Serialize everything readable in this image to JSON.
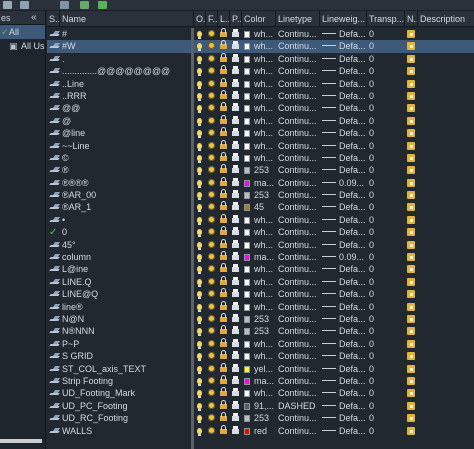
{
  "toolbar": {
    "icons": [
      "new-layer-icon",
      "layer-state-icon",
      "layer-filter-icon",
      "refresh-icon"
    ]
  },
  "left_pane": {
    "header_label": "es",
    "collapse_label": "«",
    "items": [
      {
        "label": "All",
        "glyph": "✓",
        "selected": true
      },
      {
        "label": "All Us",
        "glyph": "▣",
        "selected": false
      }
    ]
  },
  "columns": {
    "status": "S..",
    "name": "Name",
    "on": "O..",
    "freeze": "F..",
    "lock": "L..",
    "plot": "P..",
    "color": "Color",
    "linetype": "Linetype",
    "lineweight": "Lineweig...",
    "transparency": "Transp...",
    "new_vp_freeze": "N..",
    "description": "Description"
  },
  "layers": [
    {
      "name": "#",
      "color": "wh...",
      "swatch": "#ffffff",
      "linetype": "Continu...",
      "lineweight": "Defa...",
      "transp": "0",
      "current": false,
      "selected": false
    },
    {
      "name": "#W",
      "color": "wh...",
      "swatch": "#ffffff",
      "linetype": "Continu...",
      "lineweight": "Defa...",
      "transp": "0",
      "current": false,
      "selected": true
    },
    {
      "name": ".",
      "color": "wh...",
      "swatch": "#ffffff",
      "linetype": "Continu...",
      "lineweight": "Defa...",
      "transp": "0",
      "current": false,
      "selected": false
    },
    {
      "name": "..............@@@@@@@@",
      "color": "wh...",
      "swatch": "#ffffff",
      "linetype": "Continu...",
      "lineweight": "Defa...",
      "transp": "0",
      "current": false,
      "selected": false
    },
    {
      "name": "..Line",
      "color": "wh...",
      "swatch": "#ffffff",
      "linetype": "Continu...",
      "lineweight": "Defa...",
      "transp": "0",
      "current": false,
      "selected": false
    },
    {
      "name": "..RRR",
      "color": "wh...",
      "swatch": "#ffffff",
      "linetype": "Continu...",
      "lineweight": "Defa...",
      "transp": "0",
      "current": false,
      "selected": false
    },
    {
      "name": "@@",
      "color": "wh...",
      "swatch": "#ffffff",
      "linetype": "Continu...",
      "lineweight": "Defa...",
      "transp": "0",
      "current": false,
      "selected": false
    },
    {
      "name": "@",
      "color": "wh...",
      "swatch": "#ffffff",
      "linetype": "Continu...",
      "lineweight": "Defa...",
      "transp": "0",
      "current": false,
      "selected": false
    },
    {
      "name": "@line",
      "color": "wh...",
      "swatch": "#ffffff",
      "linetype": "Continu...",
      "lineweight": "Defa...",
      "transp": "0",
      "current": false,
      "selected": false
    },
    {
      "name": "~~Line",
      "color": "wh...",
      "swatch": "#ffffff",
      "linetype": "Continu...",
      "lineweight": "Defa...",
      "transp": "0",
      "current": false,
      "selected": false
    },
    {
      "name": "©",
      "color": "wh...",
      "swatch": "#ffffff",
      "linetype": "Continu...",
      "lineweight": "Defa...",
      "transp": "0",
      "current": false,
      "selected": false
    },
    {
      "name": "®",
      "color": "253",
      "swatch": "#bdbdbd",
      "linetype": "Continu...",
      "lineweight": "Defa...",
      "transp": "0",
      "current": false,
      "selected": false
    },
    {
      "name": "®®®®",
      "color": "ma...",
      "swatch": "#ff00ff",
      "linetype": "Continu...",
      "lineweight": "0.09...",
      "transp": "0",
      "current": false,
      "selected": false
    },
    {
      "name": "®AR_00",
      "color": "253",
      "swatch": "#bdbdbd",
      "linetype": "Continu...",
      "lineweight": "Defa...",
      "transp": "0",
      "current": false,
      "selected": false
    },
    {
      "name": "®AR_1",
      "color": "45",
      "swatch": "#a8792d",
      "linetype": "Continu...",
      "lineweight": "Defa...",
      "transp": "0",
      "current": false,
      "selected": false
    },
    {
      "name": "•",
      "color": "wh...",
      "swatch": "#ffffff",
      "linetype": "Continu...",
      "lineweight": "Defa...",
      "transp": "0",
      "current": false,
      "selected": false
    },
    {
      "name": "0",
      "color": "wh...",
      "swatch": "#ffffff",
      "linetype": "Continu...",
      "lineweight": "Defa...",
      "transp": "0",
      "current": true,
      "selected": false
    },
    {
      "name": "45°",
      "color": "wh...",
      "swatch": "#ffffff",
      "linetype": "Continu...",
      "lineweight": "Defa...",
      "transp": "0",
      "current": false,
      "selected": false
    },
    {
      "name": "column",
      "color": "ma...",
      "swatch": "#ff00ff",
      "linetype": "Continu...",
      "lineweight": "0.09...",
      "transp": "0",
      "current": false,
      "selected": false
    },
    {
      "name": "L@ine",
      "color": "wh...",
      "swatch": "#ffffff",
      "linetype": "Continu...",
      "lineweight": "Defa...",
      "transp": "0",
      "current": false,
      "selected": false
    },
    {
      "name": "LINE.Q",
      "color": "wh...",
      "swatch": "#ffffff",
      "linetype": "Continu...",
      "lineweight": "Defa...",
      "transp": "0",
      "current": false,
      "selected": false
    },
    {
      "name": "LINE@Q",
      "color": "wh...",
      "swatch": "#ffffff",
      "linetype": "Continu...",
      "lineweight": "Defa...",
      "transp": "0",
      "current": false,
      "selected": false
    },
    {
      "name": "line®",
      "color": "wh...",
      "swatch": "#ffffff",
      "linetype": "Continu...",
      "lineweight": "Defa...",
      "transp": "0",
      "current": false,
      "selected": false
    },
    {
      "name": "N@N",
      "color": "253",
      "swatch": "#bdbdbd",
      "linetype": "Continu...",
      "lineweight": "Defa...",
      "transp": "0",
      "current": false,
      "selected": false
    },
    {
      "name": "N®NNN",
      "color": "253",
      "swatch": "#bdbdbd",
      "linetype": "Continu...",
      "lineweight": "Defa...",
      "transp": "0",
      "current": false,
      "selected": false
    },
    {
      "name": "P~P",
      "color": "wh...",
      "swatch": "#ffffff",
      "linetype": "Continu...",
      "lineweight": "Defa...",
      "transp": "0",
      "current": false,
      "selected": false
    },
    {
      "name": "S GRID",
      "color": "wh...",
      "swatch": "#ffffff",
      "linetype": "Continu...",
      "lineweight": "Defa...",
      "transp": "0",
      "current": false,
      "selected": false
    },
    {
      "name": "ST_COL_axis_TEXT",
      "color": "yel...",
      "swatch": "#ffff00",
      "linetype": "Continu...",
      "lineweight": "Defa...",
      "transp": "0",
      "current": false,
      "selected": false
    },
    {
      "name": "Strip Footing",
      "color": "ma...",
      "swatch": "#ff00ff",
      "linetype": "Continu...",
      "lineweight": "Defa...",
      "transp": "0",
      "current": false,
      "selected": false
    },
    {
      "name": "UD_Footing_Mark",
      "color": "wh...",
      "swatch": "#ffffff",
      "linetype": "Continu...",
      "lineweight": "Defa...",
      "transp": "0",
      "current": false,
      "selected": false
    },
    {
      "name": "UD_PC_Footing",
      "color": "91,...",
      "swatch": "#5b5b5b",
      "linetype": "DASHED",
      "lineweight": "Defa...",
      "transp": "0",
      "current": false,
      "selected": false
    },
    {
      "name": "UD_RC_Footing",
      "color": "253",
      "swatch": "#bdbdbd",
      "linetype": "Continu...",
      "lineweight": "Defa...",
      "transp": "0",
      "current": false,
      "selected": false
    },
    {
      "name": "WALLS",
      "color": "red",
      "swatch": "#ff0000",
      "linetype": "Continu...",
      "lineweight": "Defa...",
      "transp": "0",
      "current": false,
      "selected": false
    }
  ]
}
